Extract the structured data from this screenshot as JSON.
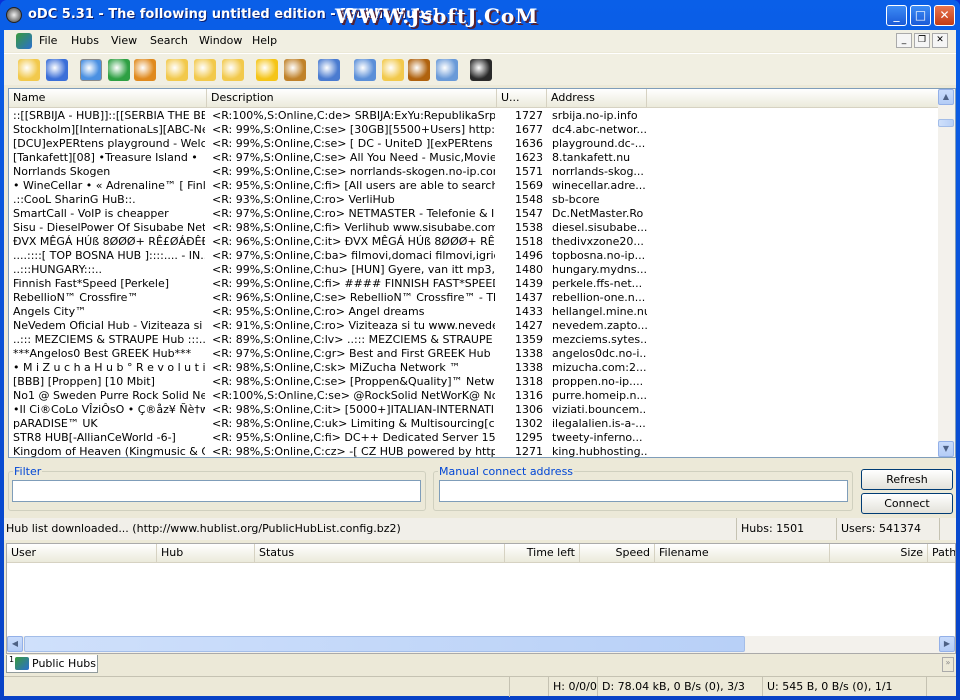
{
  "window": {
    "title": "oDC 5.31 - The following untitled edition - [Public Hubs]",
    "watermark": "WWW.JsoftJ.CoM"
  },
  "menu": [
    "File",
    "Hubs",
    "View",
    "Search",
    "Window",
    "Help"
  ],
  "toolbar_icons": [
    "open-filelist-icon",
    "settings-icon",
    "public-hubs-icon",
    "reconnect-icon",
    "follow-redirect-icon",
    "open-own-list-icon",
    "refresh-list-icon",
    "match-queue-icon",
    "favorite-hubs-icon",
    "favorite-users-icon",
    "notepad-icon",
    "search-icon",
    "adl-search-icon",
    "search-spy-icon",
    "network-stats-icon",
    "system-log-icon"
  ],
  "hubs": {
    "columns": [
      "Name",
      "Description",
      "U...",
      "Address"
    ],
    "rows": [
      [
        "::[[SRBIJA - HUB]]::[[SERBIA THE BE...",
        "<R:100%,S:Online,C:de> SRBIJA:ExYu:RepublikaSrps...",
        "1727",
        "srbija.no-ip.info"
      ],
      [
        "Stockholm][InternationaLs][ABC-Net...",
        "<R: 99%,S:Online,C:se> [30GB][5500+Users] http://...",
        "1677",
        "dc4.abc-networ..."
      ],
      [
        "[DCU]exPERtens playground - Welco...",
        "<R: 99%,S:Online,C:se> [ DC - UniteD ][exPERtens Pl...",
        "1636",
        "playground.dc-..."
      ],
      [
        "[Tankafett][08] •Treasure Island •",
        "<R: 97%,S:Online,C:se> All You Need - Music,Movies,...",
        "1623",
        "8.tankafett.nu"
      ],
      [
        "Norrlands Skogen",
        "<R: 99%,S:Online,C:se> norrlands-skogen.no-ip.com:...",
        "1571",
        "norrlands-skog..."
      ],
      [
        "• WineCellar • « Adrenaline™ [ Finlan...",
        "<R: 95%,S:Online,C:fi> [All users are able to search, ...",
        "1569",
        "winecellar.adre..."
      ],
      [
        ".::CooL SharinG HuB::.",
        "<R: 93%,S:Online,C:ro> VerliHub",
        "1548",
        "sb-bcore"
      ],
      [
        "SmartCall - VoIP is cheapper",
        "<R: 97%,S:Online,C:ro> NETMASTER - Telefonie & Int...",
        "1547",
        "Dc.NetMaster.Ro"
      ],
      [
        "Sisu - DieselPower Of Sisubabe Netw...",
        "<R: 98%,S:Online,C:fi> Verlihub www.sisubabe.com",
        "1538",
        "diesel.sisubabe..."
      ],
      [
        "ÐVX MÊGÁ HÚß 8ØØØ+ RÊ£ØÁÐÊÐ ...",
        "<R: 96%,S:Online,C:it> ÐVX MÊGÁ HÚß 8ØØØ+ RÊ£Ø...",
        "1518",
        "thedivxzone20..."
      ],
      [
        "....::::[ TOP BOSNA HUB ]::::.... - IN...",
        "<R: 97%,S:Online,C:ba> filmovi,domaci filmovi,igrice,p...",
        "1496",
        "topbosna.no-ip..."
      ],
      [
        "..:::HUNGARY:::..",
        "<R: 99%,S:Online,C:hu> [HUN] Gyere, van itt mp3, g...",
        "1480",
        "hungary.mydns..."
      ],
      [
        "Finnish Fast*Speed [Perkele]",
        "<R: 99%,S:Online,C:fi> #### FINNISH FAST*SPEED ...",
        "1439",
        "perkele.ffs-net..."
      ],
      [
        "RebellioN™ Crossfire™",
        "<R: 96%,S:Online,C:se> RebellioN™ Crossfire™ - The...",
        "1437",
        "rebellion-one.n..."
      ],
      [
        "Angels City™",
        "<R: 95%,S:Online,C:ro> Angel dreams",
        "1433",
        "hellangel.mine.nu"
      ],
      [
        "NeVedem Oficial Hub - Viziteaza si tu ...",
        "<R: 91%,S:Online,C:ro> Viziteaza si tu www.nevedem...",
        "1427",
        "nevedem.zapto..."
      ],
      [
        "..::: MEZCIEMS & STRAUPE Hub :::..",
        "<R: 89%,S:Online,C:lv> ..::: MEZCIEMS & STRAUPE H...",
        "1359",
        "mezciems.sytes..."
      ],
      [
        "***Angelos0 Best GREEK Hub***",
        "<R: 97%,S:Online,C:gr> Best and First GREEK Hub",
        "1338",
        "angelos0dc.no-i..."
      ],
      [
        "• M i Z u c h a H u b ° R e v o l u t i o ...",
        "<R: 98%,S:Online,C:sk> MiZucha Network ™",
        "1338",
        "mizucha.com:2..."
      ],
      [
        "[BBB] [Proppen] [10 Mbit]",
        "<R: 98%,S:Online,C:se> [Proppen&Quality]™ Networ...",
        "1318",
        "proppen.no-ip...."
      ],
      [
        "No1 @ Sweden Purre Rock Solid Net...",
        "<R:100%,S:Online,C:se> @RockSolid NetWorK@ No1 ...",
        "1316",
        "purre.homeip.n..."
      ],
      [
        "•Il Ci®CoLo VÎziÔsO • Ç®åz¥ Ñè†w...",
        "<R: 98%,S:Online,C:it> [5000+]ITALIAN-INTERNATI...",
        "1306",
        "viziati.bouncem..."
      ],
      [
        "pARADISE™ UK",
        "<R: 98%,S:Online,C:uk> Limiting & Multisourcing[chat]...",
        "1302",
        "ilegalalien.is-a-..."
      ],
      [
        "STR8 HUB[-AllianCeWorld -6-]",
        "<R: 95%,S:Online,C:fi> DC++ Dedicated Server 15.0...",
        "1295",
        "tweety-inferno..."
      ],
      [
        "Kingdom of Heaven (Kingmusic & Gam...",
        "<R: 98%,S:Online,C:cz> -[ CZ HUB powered by http:/...",
        "1271",
        "king.hubhosting..."
      ]
    ]
  },
  "filter": {
    "label": "Filter",
    "value": ""
  },
  "manual": {
    "label": "Manual connect address",
    "value": ""
  },
  "buttons": {
    "refresh": "Refresh",
    "connect": "Connect"
  },
  "status": {
    "message": "Hub list downloaded... (http://www.hublist.org/PublicHubList.config.bz2)",
    "hubs": "Hubs: 1501",
    "users": "Users: 541374"
  },
  "transfers": {
    "columns": [
      "User",
      "Hub",
      "Status",
      "Time left",
      "Speed",
      "Filename",
      "Size",
      "Path"
    ]
  },
  "tabs": [
    {
      "label": "Public Hubs",
      "number": "1"
    }
  ],
  "statusbar": {
    "h": "H: 0/0/0",
    "d": "D: 78.04 kB, 0 B/s (0), 3/3",
    "u": "U: 545 B, 0 B/s (0), 1/1"
  }
}
